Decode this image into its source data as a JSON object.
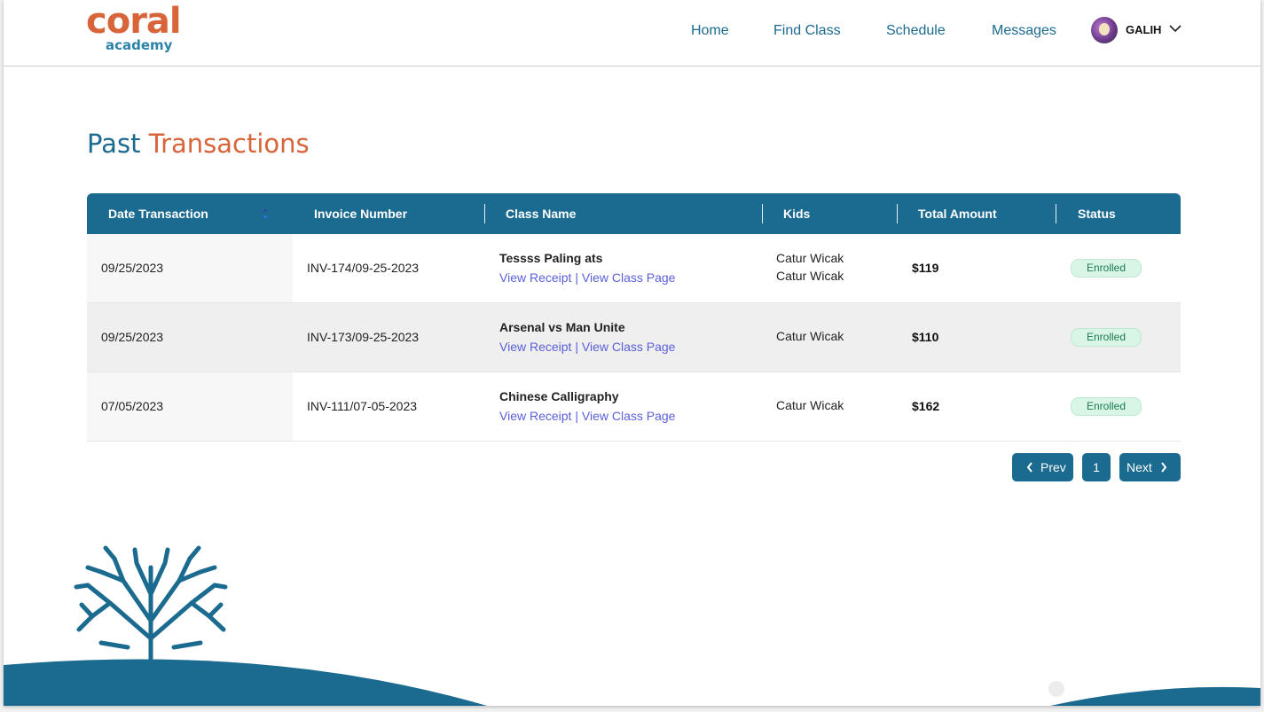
{
  "brand": {
    "logo_main": "coral",
    "logo_sub": "academy"
  },
  "nav": {
    "home": "Home",
    "find_class": "Find Class",
    "schedule": "Schedule",
    "messages": "Messages",
    "user_name": "GALIH"
  },
  "page": {
    "title_part1": "Past",
    "title_part2": "Transactions"
  },
  "table": {
    "headers": [
      "Date Transaction",
      "Invoice Number",
      "Class Name",
      "Kids",
      "Total Amount",
      "Status"
    ],
    "rows": [
      {
        "date": "09/25/2023",
        "invoice": "INV-174/09-25-2023",
        "class_name": "Tessss Paling ats",
        "view_receipt": "View Receipt",
        "separator": "|",
        "view_class": "View Class Page",
        "kids": [
          "Catur Wicak",
          "Catur Wicak"
        ],
        "amount": "$119",
        "status": "Enrolled"
      },
      {
        "date": "09/25/2023",
        "invoice": "INV-173/09-25-2023",
        "class_name": "Arsenal vs Man Unite",
        "view_receipt": "View Receipt",
        "separator": "|",
        "view_class": "View Class Page",
        "kids": [
          "Catur Wicak"
        ],
        "amount": "$110",
        "status": "Enrolled"
      },
      {
        "date": "07/05/2023",
        "invoice": "INV-111/07-05-2023",
        "class_name": "Chinese Calligraphy",
        "view_receipt": "View Receipt",
        "separator": "|",
        "view_class": "View Class Page",
        "kids": [
          "Catur Wicak"
        ],
        "amount": "$162",
        "status": "Enrolled"
      }
    ]
  },
  "pagination": {
    "prev": "Prev",
    "page": "1",
    "next": "Next"
  },
  "colors": {
    "primary": "#1b6a8f",
    "accent": "#d8643a",
    "link": "#5a5fd8",
    "status_bg": "#d8f5e6",
    "status_text": "#1c7a4f"
  },
  "icons": {
    "sort": "sort-arrows-icon",
    "user_menu": "chevron-down-icon",
    "prev": "chevron-left-icon",
    "next": "chevron-right-icon",
    "decor": "coral-tree-icon"
  }
}
